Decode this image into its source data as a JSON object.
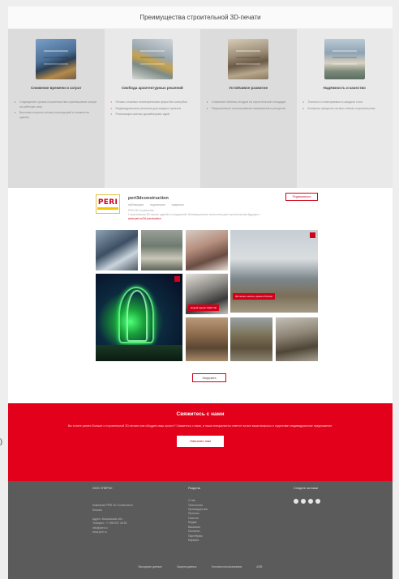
{
  "advantages": {
    "title": "Преимущества строительной 3D-печати",
    "items": [
      {
        "name": "Снижение времени и затрат",
        "points": [
          "Сокращение сроков строительства и уменьшение затрат на рабочую силу",
          "Высокая скорость печати конструкций и элементов здания"
        ]
      },
      {
        "name": "Свобода архитектурных решений",
        "points": [
          "Печать сложных геометрических форм без опалубки",
          "Индивидуальные решения для каждого проекта",
          "Реализация смелых дизайнерских идей"
        ]
      },
      {
        "name": "Устойчивое развитие",
        "points": [
          "Снижение объёма отходов на строительной площадке",
          "Рациональное использование материалов и ресурсов"
        ]
      },
      {
        "name": "Надёжность и качество",
        "points": [
          "Точность и повторяемость каждого слоя",
          "Контроль процесса на всех этапах строительства"
        ]
      }
    ]
  },
  "instagram": {
    "logo_text": "PERI",
    "username": "peri3dconstruction",
    "stats": [
      "публикации",
      "подписчики",
      "подписки"
    ],
    "desc_line1": "PERI 3D Construction",
    "desc_line2": "Строительная 3D-печать зданий и сооружений. Инновационные технологии для строительства будущего.",
    "desc_link": "www.peri.ru/3d-construction",
    "follow_label": "Подписаться",
    "tile_caption_4": "3D-печать жилого дома в России",
    "tile_caption_6": "Новый проект PERI 3D",
    "load_more_label": "Загрузить"
  },
  "contact": {
    "title": "Свяжитесь с нами",
    "text": "Вы хотите узнать больше о строительной 3D-печати или обсудить ваш проект? Свяжитесь с нами, и наши специалисты ответят на все ваши вопросы и подготовят индивидуальное предложение.",
    "button_label": "Написать нам"
  },
  "footer": {
    "col1_head": "ООО «ПЕРИ»",
    "col1_sub": [
      "Компания PERI 3D Construction",
      "Москва"
    ],
    "col1_lines": [
      "Адрес: Московская обл.",
      "Телефон: +7 495 937 26 50",
      "info@peri.ru",
      "www.peri.ru"
    ],
    "col2_head": "Разделы",
    "col2_lines": [
      "О нас",
      "Технология",
      "Преимущества",
      "Проекты",
      "Новости",
      "Медиа",
      "Вакансии",
      "Контакты",
      "Партнёрам",
      "Карьера"
    ],
    "col3_head": "Следите за нами",
    "bottom_links": [
      "Выходные данные",
      "Защита данных",
      "Условия использования",
      "AGB"
    ]
  },
  "edge_char": ")"
}
